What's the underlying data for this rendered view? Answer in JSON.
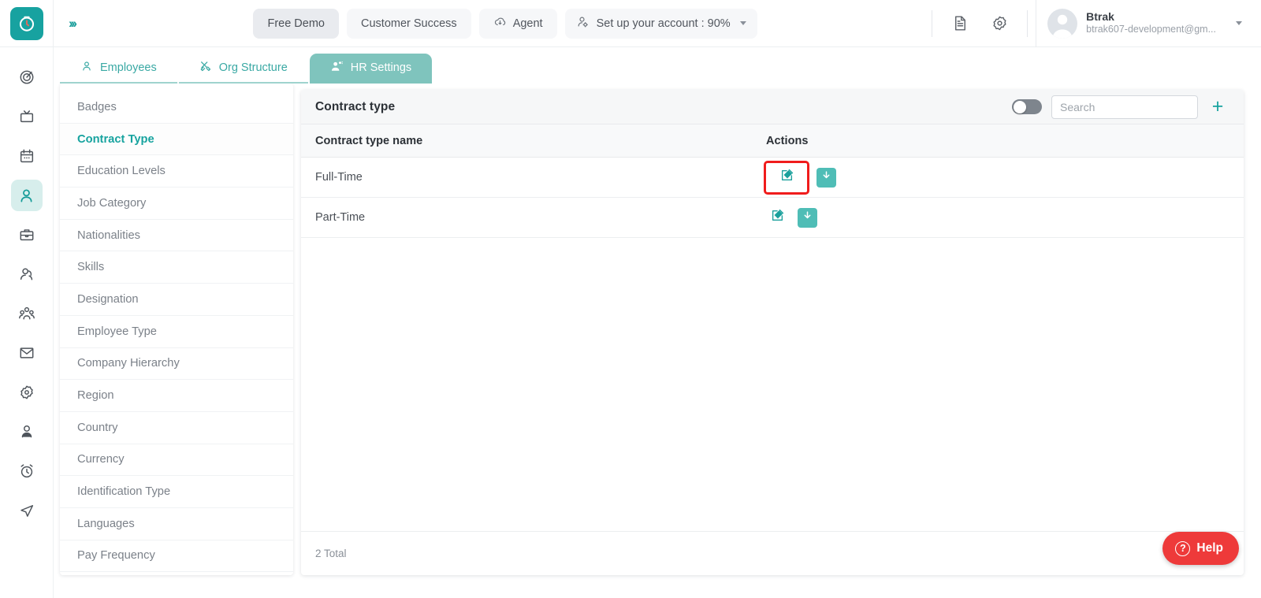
{
  "topbar": {
    "logo_icon": "clock-logo-icon",
    "expand_icon": "chevron-double-right-icon",
    "buttons": [
      {
        "label": "Free Demo",
        "icon": "",
        "style": "active-demo"
      },
      {
        "label": "Customer Success",
        "icon": "",
        "style": "plain"
      },
      {
        "label": "Agent",
        "icon": "cloud-download-icon",
        "style": "plain"
      },
      {
        "label": "Set up your account : 90%",
        "icon": "user-settings-icon",
        "style": "setup"
      }
    ],
    "doc_icon": "document-icon",
    "gear_icon": "gear-icon",
    "user": {
      "name": "Btrak",
      "email": "btrak607-development@gm...",
      "avatar_icon": "avatar-placeholder-icon",
      "caret_icon": "chevron-down-icon"
    }
  },
  "rail": {
    "items": [
      {
        "icon": "target-dashboard-icon",
        "selected": false
      },
      {
        "icon": "tv-screen-icon",
        "selected": false
      },
      {
        "icon": "calendar-icon",
        "selected": false
      },
      {
        "icon": "person-icon",
        "selected": true
      },
      {
        "icon": "briefcase-icon",
        "selected": false
      },
      {
        "icon": "user-pair-icon",
        "selected": false
      },
      {
        "icon": "group-people-icon",
        "selected": false
      },
      {
        "icon": "mail-envelope-icon",
        "selected": false
      },
      {
        "icon": "settings-gear-icon",
        "selected": false
      },
      {
        "icon": "user-profile-icon",
        "selected": false
      },
      {
        "icon": "alarm-clock-icon",
        "selected": false
      },
      {
        "icon": "send-paper-plane-icon",
        "selected": false
      }
    ]
  },
  "tabs": [
    {
      "label": "Employees",
      "icon": "person-icon",
      "active": false
    },
    {
      "label": "Org Structure",
      "icon": "tools-icon",
      "active": false
    },
    {
      "label": "HR Settings",
      "icon": "people-gear-icon",
      "active": true
    }
  ],
  "settings_menu": {
    "items": [
      {
        "label": "Badges",
        "active": false
      },
      {
        "label": "Contract Type",
        "active": true
      },
      {
        "label": "Education Levels",
        "active": false
      },
      {
        "label": "Job Category",
        "active": false
      },
      {
        "label": "Nationalities",
        "active": false
      },
      {
        "label": "Skills",
        "active": false
      },
      {
        "label": "Designation",
        "active": false
      },
      {
        "label": "Employee Type",
        "active": false
      },
      {
        "label": "Company Hierarchy",
        "active": false
      },
      {
        "label": "Region",
        "active": false
      },
      {
        "label": "Country",
        "active": false
      },
      {
        "label": "Currency",
        "active": false
      },
      {
        "label": "Identification Type",
        "active": false
      },
      {
        "label": "Languages",
        "active": false
      },
      {
        "label": "Pay Frequency",
        "active": false
      }
    ]
  },
  "main": {
    "title": "Contract type",
    "toggle_state": "off",
    "search": {
      "value": "",
      "placeholder": "Search"
    },
    "add_label": "+",
    "columns": [
      "Contract type name",
      "Actions"
    ],
    "rows": [
      {
        "name": "Full-Time",
        "edit_icon": "edit-pencil-icon",
        "archive_icon": "archive-download-icon",
        "highlighted": true
      },
      {
        "name": "Part-Time",
        "edit_icon": "edit-pencil-icon",
        "archive_icon": "archive-download-icon",
        "highlighted": false
      }
    ],
    "footer_total": "2 Total"
  },
  "help": {
    "label": "Help",
    "icon": "question-circle-icon",
    "glyph": "?"
  },
  "colors": {
    "accent_teal": "#17a39f",
    "tab_active": "#7fc4bd",
    "archive_btn": "#4fbdb6",
    "highlight_red": "#f01c1c",
    "help_red": "#ee3a3a",
    "sidebar_active_text": "#17a39f"
  }
}
